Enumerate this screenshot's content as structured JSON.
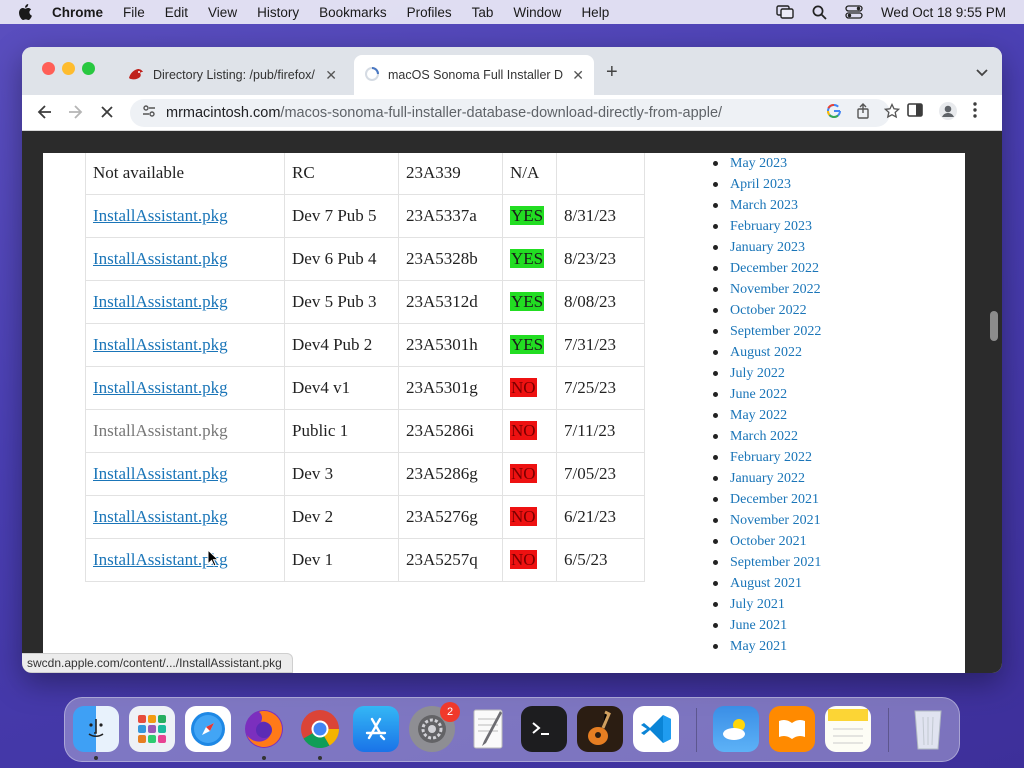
{
  "menubar": {
    "app": "Chrome",
    "items": [
      "File",
      "Edit",
      "View",
      "History",
      "Bookmarks",
      "Profiles",
      "Tab",
      "Window",
      "Help"
    ],
    "clock": "Wed Oct 18  9:55 PM"
  },
  "tabs": [
    {
      "title": "Directory Listing: /pub/firefox/",
      "icon": "firefox-ftp-icon"
    },
    {
      "title": "macOS Sonoma Full Installer D",
      "icon": "loading-spinner-icon"
    }
  ],
  "address": {
    "host": "mrmacintosh.com",
    "path": "/macos-sonoma-full-installer-database-download-directly-from-apple/"
  },
  "installer_rows": [
    {
      "file": "Not available",
      "build_name": "RC",
      "build": "23A339",
      "status": "N/A",
      "date": ""
    },
    {
      "file": "InstallAssistant.pkg",
      "build_name": "Dev 7 Pub 5",
      "build": "23A5337a",
      "status": "YES",
      "date": "8/31/23"
    },
    {
      "file": "InstallAssistant.pkg",
      "build_name": "Dev 6 Pub 4",
      "build": "23A5328b",
      "status": "YES",
      "date": "8/23/23"
    },
    {
      "file": "InstallAssistant.pkg",
      "build_name": "Dev 5 Pub 3",
      "build": "23A5312d",
      "status": "YES",
      "date": "8/08/23"
    },
    {
      "file": "InstallAssistant.pkg",
      "build_name": "Dev4 Pub 2",
      "build": "23A5301h",
      "status": "YES",
      "date": "7/31/23"
    },
    {
      "file": "InstallAssistant.pkg",
      "build_name": "Dev4 v1",
      "build": "23A5301g",
      "status": "NO",
      "date": "7/25/23"
    },
    {
      "file": "InstallAssistant.pkg",
      "build_name": "Public 1",
      "build": "23A5286i",
      "status": "NO",
      "date": "7/11/23"
    },
    {
      "file": "InstallAssistant.pkg",
      "build_name": "Dev 3",
      "build": "23A5286g",
      "status": "NO",
      "date": "7/05/23"
    },
    {
      "file": "InstallAssistant.pkg",
      "build_name": "Dev 2",
      "build": "23A5276g",
      "status": "NO",
      "date": "6/21/23"
    },
    {
      "file": "InstallAssistant.pkg",
      "build_name": "Dev 1",
      "build": "23A5257q",
      "status": "NO",
      "date": "6/5/23"
    }
  ],
  "archives": [
    "May 2023",
    "April 2023",
    "March 2023",
    "February 2023",
    "January 2023",
    "December 2022",
    "November 2022",
    "October 2022",
    "September 2022",
    "August 2022",
    "July 2022",
    "June 2022",
    "May 2022",
    "March 2022",
    "February 2022",
    "January 2022",
    "December 2021",
    "November 2021",
    "October 2021",
    "September 2021",
    "August 2021",
    "July 2021",
    "June 2021",
    "May 2021"
  ],
  "status_bar": "swcdn.apple.com/content/.../InstallAssistant.pkg",
  "dock": {
    "settings_badge": "2",
    "items": [
      "finder-icon",
      "launchpad-icon",
      "safari-icon",
      "firefox-icon",
      "chrome-icon",
      "app-store-icon",
      "system-settings-icon",
      "textedit-icon",
      "terminal-icon",
      "garageband-icon",
      "vscode-icon",
      "weather-icon",
      "books-icon",
      "notes-icon",
      "trash-icon"
    ]
  },
  "colors": {
    "link": "#1a75b8",
    "yes": "#22dd22",
    "no": "#ee1111",
    "desktop": "#4a3fb3"
  }
}
